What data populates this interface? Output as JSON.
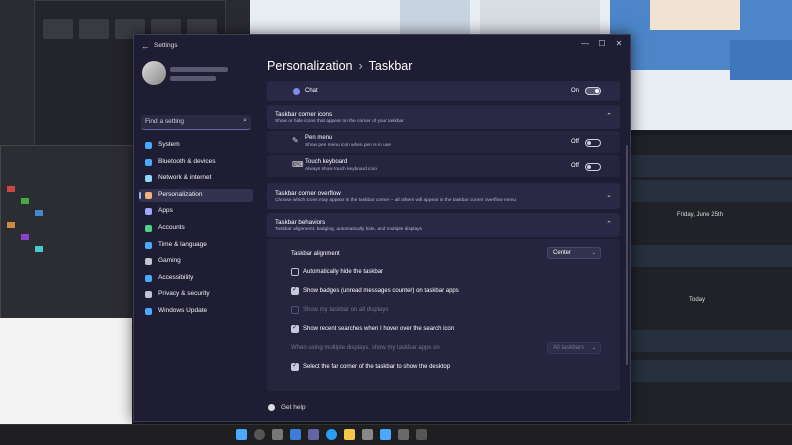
{
  "window": {
    "app_title": "Settings",
    "controls": [
      "—",
      "☐",
      "✕"
    ]
  },
  "search": {
    "placeholder": "Find a setting"
  },
  "sidebar": {
    "items": [
      {
        "label": "System",
        "color": "#4aa8ff"
      },
      {
        "label": "Bluetooth & devices",
        "color": "#4aa8ff"
      },
      {
        "label": "Network & internet",
        "color": "#8fd3ff"
      },
      {
        "label": "Personalization",
        "color": "#f0b27a",
        "active": true
      },
      {
        "label": "Apps",
        "color": "#9fa7ff"
      },
      {
        "label": "Accounts",
        "color": "#4fd18b"
      },
      {
        "label": "Time & language",
        "color": "#4aa8ff"
      },
      {
        "label": "Gaming",
        "color": "#c2c2d0"
      },
      {
        "label": "Accessibility",
        "color": "#4aa8ff"
      },
      {
        "label": "Privacy & security",
        "color": "#c2c2d0"
      },
      {
        "label": "Windows Update",
        "color": "#4aa8ff"
      }
    ]
  },
  "breadcrumb": {
    "parent": "Personalization",
    "current": "Taskbar",
    "separator": "›"
  },
  "chat": {
    "label": "Chat",
    "state": "On"
  },
  "corner_icons": {
    "title": "Taskbar corner icons",
    "desc": "Show or hide icons that appear on the corner of your taskbar",
    "items": [
      {
        "label": "Pen menu",
        "sub": "Show pen menu icon when pen is in use",
        "state": "Off"
      },
      {
        "label": "Touch keyboard",
        "sub": "Always show touch keyboard icon",
        "state": "Off"
      }
    ]
  },
  "corner_overflow": {
    "title": "Taskbar corner overflow",
    "desc": "Choose which icons may appear in the taskbar corner – all others will appear in the taskbar corner overflow menu"
  },
  "behaviors": {
    "title": "Taskbar behaviors",
    "desc": "Taskbar alignment, badging, automatically hide, and multiple displays",
    "alignment_label": "Taskbar alignment",
    "alignment_value": "Center",
    "options": [
      {
        "label": "Automatically hide the taskbar",
        "checked": false,
        "disabled": false
      },
      {
        "label": "Show badges (unread messages counter) on taskbar apps",
        "checked": true,
        "disabled": false
      },
      {
        "label": "Show my taskbar on all displays",
        "checked": false,
        "disabled": true
      },
      {
        "label": "Show recent searches when I hover over the search icon",
        "checked": true,
        "disabled": false
      }
    ],
    "multi_display_label": "When using multiple displays, show my taskbar apps on",
    "multi_display_value": "All taskbars",
    "far_corner_label": "Select the far corner of the taskbar to show the desktop",
    "far_corner_checked": true
  },
  "help": {
    "label": "Get help"
  },
  "background": {
    "calendar_date": "Friday, June 25th",
    "today_label": "Today"
  },
  "colors": {
    "accent": "#8fb4ff",
    "window_bg": "#1f1d33",
    "card_bg": "#2a2845"
  }
}
